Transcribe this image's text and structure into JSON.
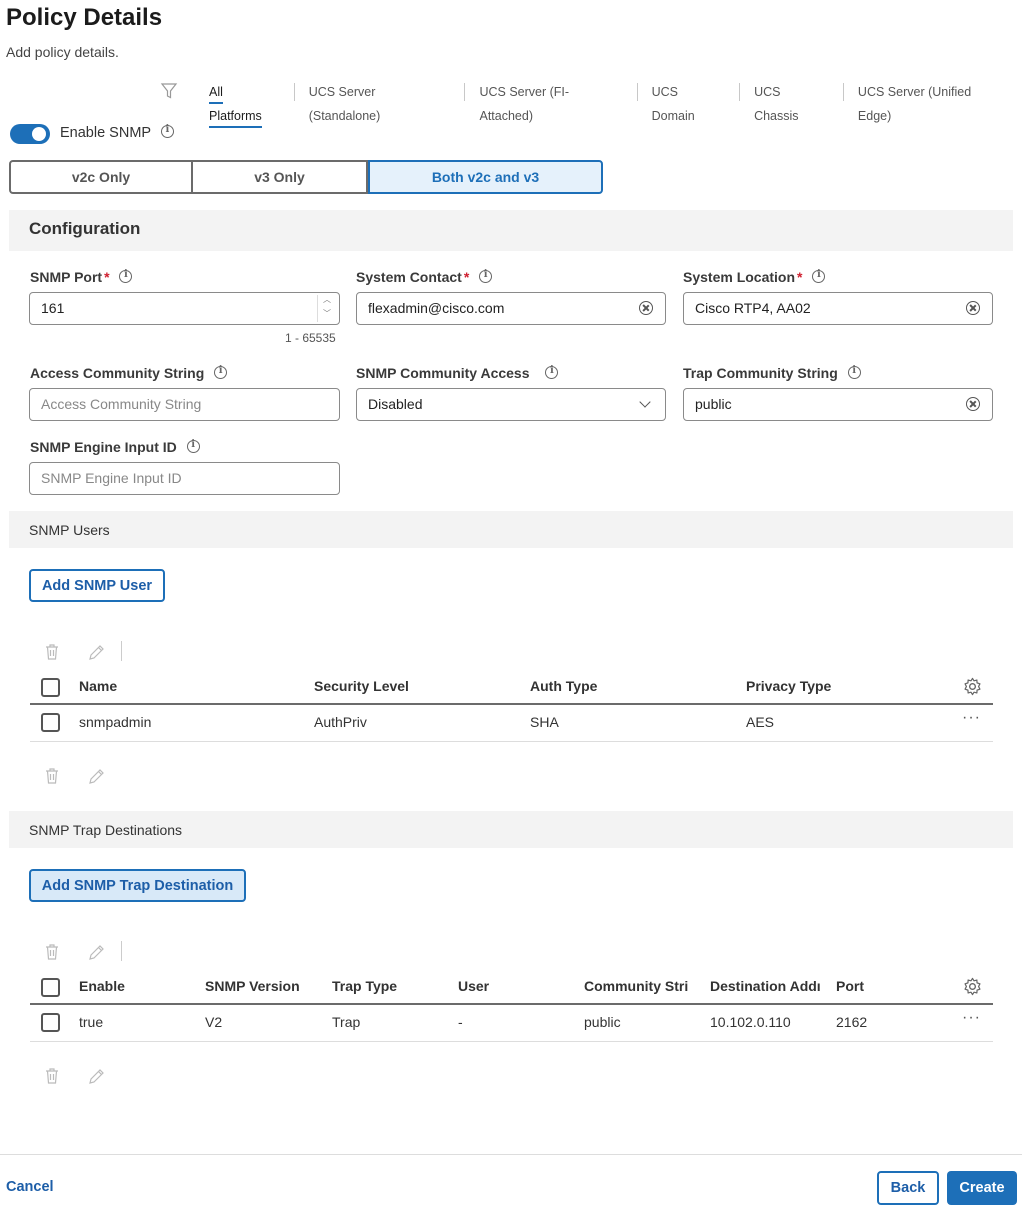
{
  "page": {
    "title": "Policy Details",
    "subtitle": "Add policy details."
  },
  "platform_tabs": [
    {
      "label": "All Platforms",
      "active": true
    },
    {
      "label": "UCS Server (Standalone)",
      "active": false
    },
    {
      "label": "UCS Server (FI-Attached)",
      "active": false
    },
    {
      "label": "UCS Domain",
      "active": false
    },
    {
      "label": "UCS Chassis",
      "active": false
    },
    {
      "label": "UCS Server (Unified Edge)",
      "active": false
    }
  ],
  "enable_snmp": {
    "label": "Enable SNMP",
    "on": true
  },
  "version_options": [
    {
      "label": "v2c Only",
      "selected": false
    },
    {
      "label": "v3 Only",
      "selected": false
    },
    {
      "label": "Both v2c and v3",
      "selected": true
    }
  ],
  "configuration": {
    "heading": "Configuration",
    "snmp_port": {
      "label": "SNMP Port",
      "value": "161",
      "hint": "1 - 65535"
    },
    "system_contact": {
      "label": "System Contact",
      "value": "flexadmin@cisco.com"
    },
    "system_location": {
      "label": "System Location",
      "value": "Cisco RTP4, AA02"
    },
    "access_community": {
      "label": "Access Community String",
      "placeholder": "Access Community String"
    },
    "community_access": {
      "label": "SNMP Community Access",
      "value": "Disabled"
    },
    "trap_community": {
      "label": "Trap Community String",
      "value": "public"
    },
    "engine_id": {
      "label": "SNMP Engine Input ID",
      "placeholder": "SNMP Engine Input ID"
    }
  },
  "snmp_users": {
    "heading": "SNMP Users",
    "add_label": "Add SNMP User",
    "columns": [
      "Name",
      "Security Level",
      "Auth Type",
      "Privacy Type"
    ],
    "rows": [
      {
        "name": "snmpadmin",
        "security_level": "AuthPriv",
        "auth_type": "SHA",
        "privacy_type": "AES"
      }
    ]
  },
  "trap_destinations": {
    "heading": "SNMP Trap Destinations",
    "add_label": "Add SNMP Trap Destination",
    "columns": [
      "Enable",
      "SNMP Version",
      "Trap Type",
      "User",
      "Community Stri",
      "Destination Addı",
      "Port"
    ],
    "rows": [
      {
        "enable": "true",
        "version": "V2",
        "trap_type": "Trap",
        "user": "-",
        "community": "public",
        "destination": "10.102.0.110",
        "port": "2162"
      }
    ]
  },
  "footer": {
    "cancel": "Cancel",
    "back": "Back",
    "create": "Create"
  },
  "colors": {
    "accent": "#1d6fb8",
    "required": "#cf2030"
  }
}
